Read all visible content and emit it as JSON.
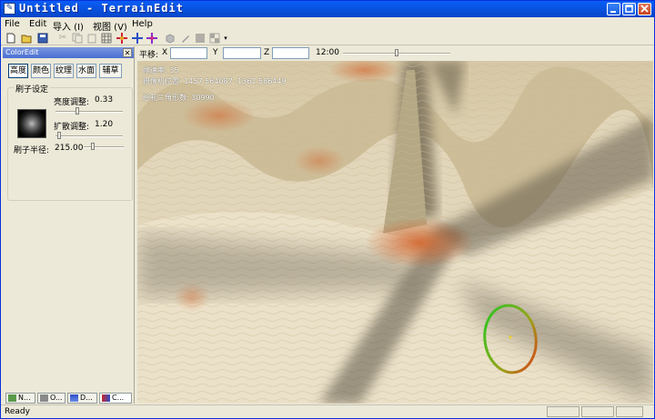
{
  "window": {
    "title": "Untitled - TerrainEdit"
  },
  "menu": [
    "File",
    "Edit",
    "导入 (I)",
    "视图 (V)",
    "Help"
  ],
  "toolbar_icons": [
    "new-file-icon",
    "open-folder-icon",
    "save-icon",
    "cut-icon",
    "copy-icon",
    "paste-icon",
    "grid-icon",
    "move-icon",
    "rotate-icon",
    "scale-icon",
    "cube-icon",
    "brush-icon",
    "square-icon",
    "checker-icon",
    "dropdown-arrow-icon"
  ],
  "panel": {
    "title": "ColorEdit",
    "tabs": [
      "高度",
      "颜色",
      "纹理",
      "水面",
      "辅草"
    ],
    "group_title": "刷子设定",
    "brightness_label": "亮度调整:",
    "brightness_value": "0.33",
    "spread_label": "扩散调整:",
    "spread_value": "1.20",
    "radius_label": "刷子半径:",
    "radius_value": "215.00",
    "brightness_level": 0.33,
    "spread_level": 0.05,
    "radius_level": 0.22
  },
  "bottom_tabs": [
    "N...",
    "O...",
    "D...",
    "C..."
  ],
  "transform": {
    "label": "平移:",
    "x_label": "X",
    "y_label": "Y",
    "z_label": "Z",
    "x_value": "",
    "y_value": "",
    "z_value": "",
    "time": "12:00",
    "time_level": 0.5
  },
  "hud": {
    "fps": "帧速率: 35",
    "camera": "摄像机位置: 1457.564087 -1361.586449",
    "triangles": "绘制三角形数: 30990"
  },
  "status": {
    "text": "Ready"
  },
  "colors": {
    "titlebar": "#0853e0",
    "brush_ring_start": "#22c922",
    "brush_ring_end": "#e03a1a",
    "sand": "#e8dcc0"
  }
}
